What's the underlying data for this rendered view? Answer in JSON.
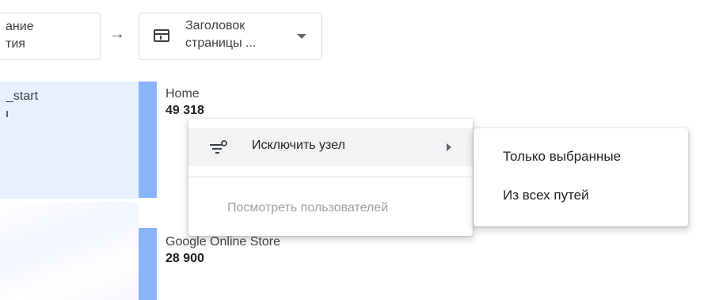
{
  "steps": {
    "left": {
      "line1": "ание",
      "line2": "тия"
    },
    "right": {
      "line1": "Заголовок",
      "line2": "страницы ..."
    }
  },
  "left_node": {
    "label": "_start"
  },
  "nodes": [
    {
      "label": "Home",
      "value": "49 318"
    },
    {
      "label": "Google Online Store",
      "value": "28 900"
    }
  ],
  "context_menu": {
    "exclude_label": "Исключить узел",
    "view_users_label": "Посмотреть пользователей"
  },
  "submenu": {
    "items": [
      "Только выбранные",
      "Из всех путей"
    ]
  },
  "icons": {
    "arrow": "arrow-right-icon",
    "table": "table-header-icon",
    "dropdown": "caret-down-icon",
    "filter": "filter-remove-icon",
    "submenu": "chevron-right-icon"
  },
  "colors": {
    "node": "#8ab4f8",
    "panel": "#e8f0fe",
    "disabled_text": "#9aa0a6",
    "hover": "#f1f3f4"
  }
}
